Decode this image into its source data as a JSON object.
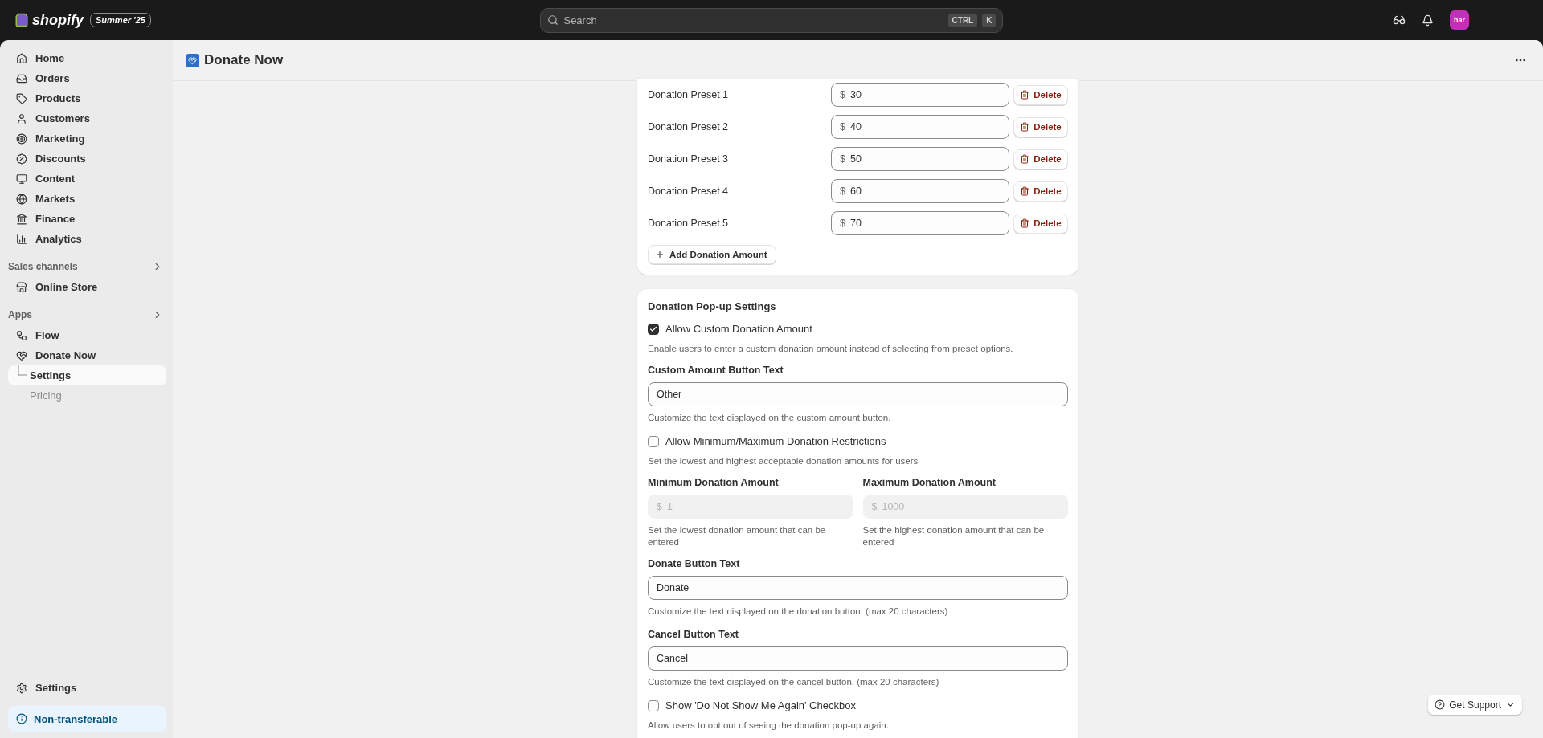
{
  "topbar": {
    "logo": "shopify",
    "badge": "Summer '25",
    "search": {
      "placeholder": "Search",
      "keys": [
        "CTRL",
        "K"
      ]
    },
    "avatar": "har"
  },
  "sidebar": {
    "items": [
      {
        "label": "Home",
        "selected": false
      },
      {
        "label": "Orders",
        "selected": false
      },
      {
        "label": "Products",
        "selected": false
      },
      {
        "label": "Customers",
        "selected": false
      },
      {
        "label": "Marketing",
        "selected": false
      },
      {
        "label": "Discounts",
        "selected": false
      },
      {
        "label": "Content",
        "selected": false
      },
      {
        "label": "Markets",
        "selected": false
      },
      {
        "label": "Finance",
        "selected": false
      },
      {
        "label": "Analytics",
        "selected": false
      }
    ],
    "sections": [
      {
        "title": "Sales channels",
        "items": [
          {
            "label": "Online Store",
            "selected": false
          }
        ]
      },
      {
        "title": "Apps",
        "items": [
          {
            "label": "Flow",
            "selected": false
          },
          {
            "label": "Donate Now",
            "selected": false,
            "children": [
              {
                "label": "Settings",
                "selected": true
              },
              {
                "label": "Pricing",
                "selected": false
              }
            ]
          }
        ]
      }
    ],
    "settings": "Settings",
    "notice": "Non-transferable"
  },
  "page": {
    "title": "Donate Now"
  },
  "presets": {
    "rows": [
      {
        "label": "Donation Preset 1",
        "currency": "$",
        "value": "30",
        "action": "Delete"
      },
      {
        "label": "Donation Preset 2",
        "currency": "$",
        "value": "40",
        "action": "Delete"
      },
      {
        "label": "Donation Preset 3",
        "currency": "$",
        "value": "50",
        "action": "Delete"
      },
      {
        "label": "Donation Preset 4",
        "currency": "$",
        "value": "60",
        "action": "Delete"
      },
      {
        "label": "Donation Preset 5",
        "currency": "$",
        "value": "70",
        "action": "Delete"
      }
    ],
    "add_button": "Add Donation Amount"
  },
  "popup_settings": {
    "title": "Donation Pop-up Settings",
    "items": [
      {
        "kind": "checkbox",
        "label": "Allow Custom Donation Amount",
        "checked": true,
        "description": "Enable users to enter a custom donation amount instead of selecting from preset options."
      },
      {
        "kind": "text",
        "label": "Custom Amount Button Text",
        "value": "Other",
        "hint": "Customize the text displayed on the custom amount button."
      },
      {
        "kind": "checkbox",
        "label": "Allow Minimum/Maximum Donation Restrictions",
        "checked": false,
        "description": "Set the lowest and highest acceptable donation amounts for users"
      },
      {
        "kind": "pair",
        "fields": [
          {
            "label": "Minimum Donation Amount",
            "currency": "$",
            "value": "1",
            "disabled": true,
            "hint": "Set the lowest donation amount that can be entered"
          },
          {
            "label": "Maximum Donation Amount",
            "currency": "$",
            "value": "1000",
            "disabled": true,
            "hint": "Set the highest donation amount that can be entered"
          }
        ]
      },
      {
        "kind": "text",
        "label": "Donate Button Text",
        "value": "Donate",
        "hint": "Customize the text displayed on the donation button. (max 20 characters)"
      },
      {
        "kind": "text",
        "label": "Cancel Button Text",
        "value": "Cancel",
        "hint": "Customize the text displayed on the cancel button. (max 20 characters)"
      },
      {
        "kind": "checkbox",
        "label": "Show 'Do Not Show Me Again' Checkbox",
        "checked": false,
        "description": "Allow users to opt out of seeing the donation pop-up again."
      }
    ]
  },
  "support_button": "Get Support"
}
